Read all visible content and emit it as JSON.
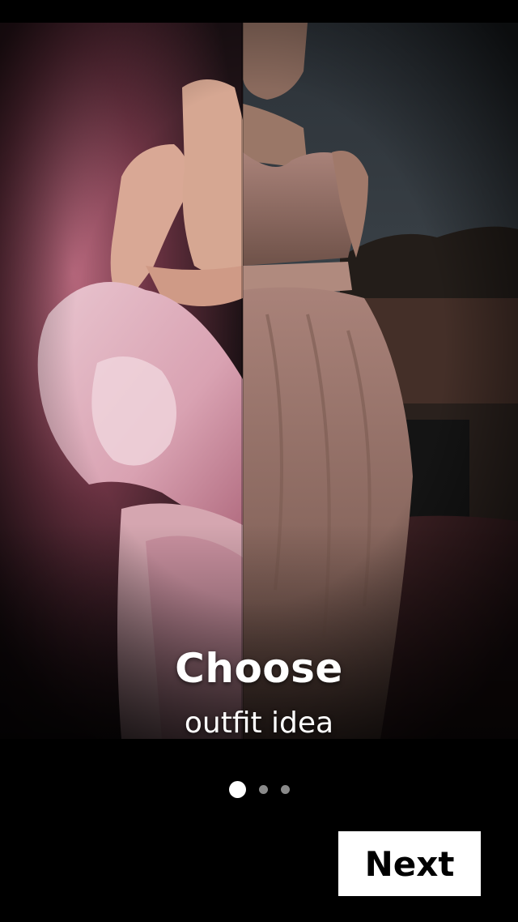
{
  "onboarding": {
    "title": "Choose",
    "subtitle": "outfit idea",
    "pager": {
      "total": 3,
      "active_index": 0
    },
    "next_label": "Next"
  },
  "colors": {
    "background": "#000000",
    "text": "#ffffff",
    "button_bg": "#ffffff",
    "button_text": "#000000",
    "dot_active": "#ffffff",
    "dot_inactive": "#8a8a8a"
  }
}
